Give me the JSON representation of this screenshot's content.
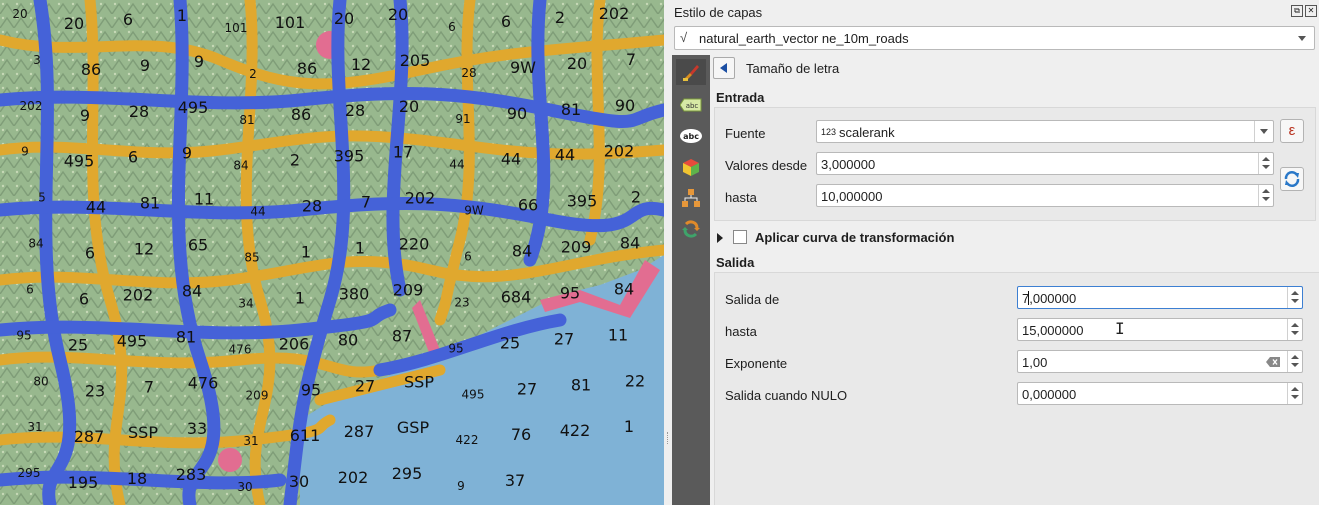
{
  "dock": {
    "title": "Estilo de capas",
    "float_glyph": "⧉",
    "close_glyph": "✕",
    "layer_icon": "vector-line-layer-icon",
    "layer_name": "natural_earth_vector ne_10m_roads"
  },
  "side_tabs": [
    {
      "name": "symbology-tab",
      "icon": "paintbrush-icon"
    },
    {
      "name": "labels-tab",
      "icon": "abc-label-icon",
      "glyph": "abc"
    },
    {
      "name": "masks-tab",
      "icon": "abc-mask-icon",
      "glyph": "abc"
    },
    {
      "name": "3d-view-tab",
      "icon": "3d-cube-icon"
    },
    {
      "name": "diagrams-tab",
      "icon": "diagram-icon"
    },
    {
      "name": "history-tab",
      "icon": "history-icon"
    }
  ],
  "header": {
    "title": "Tamaño de letra"
  },
  "input": {
    "section_label": "Entrada",
    "source_label": "Fuente",
    "source_type_glyph": "123",
    "source_value": "scalerank",
    "expression_glyph": "ε",
    "from_label": "Valores desde",
    "from_value": "3,000000",
    "to_label": "hasta",
    "to_value": "10,000000"
  },
  "curve": {
    "label": "Aplicar curva de transformación",
    "checked": false
  },
  "output": {
    "section_label": "Salida",
    "from_label": "Salida de",
    "from_value": "7,000000",
    "to_label": "hasta",
    "to_value": "15,000000",
    "exponent_label": "Exponente",
    "exponent_value": "1,00",
    "null_label": "Salida cuando NULO",
    "null_value": "0,000000"
  },
  "map": {
    "colors": {
      "primary_road": "#4562d8",
      "secondary_road": "#e0a82e",
      "urban": "#e26d91",
      "sea": "#7fb2d6",
      "terrain": "#8fae86"
    },
    "road_labels": [
      "20",
      "20",
      "6",
      "1",
      "101",
      "101",
      "20",
      "20",
      "6",
      "6",
      "2",
      "202",
      "3",
      "86",
      "9",
      "9",
      "2",
      "86",
      "12",
      "205",
      "28",
      "9W",
      "20",
      "7",
      "202",
      "9",
      "28",
      "495",
      "81",
      "86",
      "28",
      "20",
      "91",
      "90",
      "81",
      "90",
      "9",
      "495",
      "6",
      "9",
      "84",
      "2",
      "395",
      "17",
      "44",
      "44",
      "44",
      "202",
      "5",
      "44",
      "81",
      "11",
      "44",
      "28",
      "7",
      "202",
      "9W",
      "66",
      "395",
      "2",
      "84",
      "6",
      "12",
      "65",
      "85",
      "1",
      "1",
      "220",
      "6",
      "84",
      "209",
      "84",
      "6",
      "6",
      "202",
      "84",
      "34",
      "1",
      "380",
      "209",
      "23",
      "684",
      "95",
      "84",
      "95",
      "25",
      "495",
      "81",
      "476",
      "206",
      "80",
      "87",
      "95",
      "25",
      "27",
      "11",
      "80",
      "23",
      "7",
      "476",
      "209",
      "95",
      "27",
      "SSP",
      "495",
      "27",
      "81",
      "22",
      "31",
      "287",
      "SSP",
      "33",
      "31",
      "611",
      "287",
      "GSP",
      "422",
      "76",
      "422",
      "1",
      "295",
      "195",
      "18",
      "283",
      "30",
      "30",
      "202",
      "295",
      "9",
      "37"
    ]
  }
}
